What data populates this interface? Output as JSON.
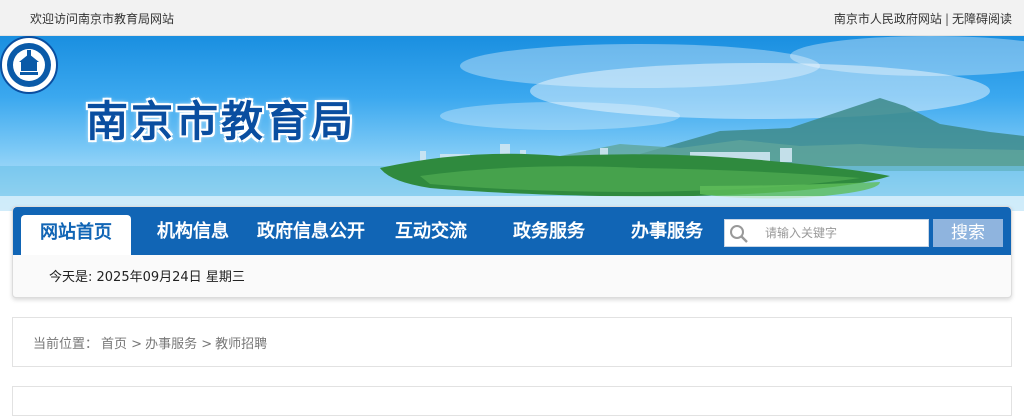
{
  "topbar": {
    "welcome": "欢迎访问南京市教育局网站",
    "links": [
      "南京市人民政府网站",
      "无障碍阅读"
    ],
    "separator": "|"
  },
  "header": {
    "site_title": "南京市教育局",
    "logo_icon": "nanjing-education-emblem"
  },
  "nav": {
    "items": [
      "网站首页",
      "机构信息",
      "政府信息公开",
      "互动交流",
      "政务服务",
      "办事服务"
    ],
    "active_index": 0,
    "search_placeholder": "请输入关键字",
    "search_button": "搜索",
    "date_text": "今天是: 2025年09月24日 星期三"
  },
  "breadcrumb": {
    "label": "当前位置：",
    "items": [
      "首页",
      "办事服务",
      "教师招聘"
    ],
    "separator": ">"
  },
  "colors": {
    "nav_blue": "#1165b5",
    "search_button": "#8fb4de",
    "title_blue": "#0a4ea0"
  }
}
